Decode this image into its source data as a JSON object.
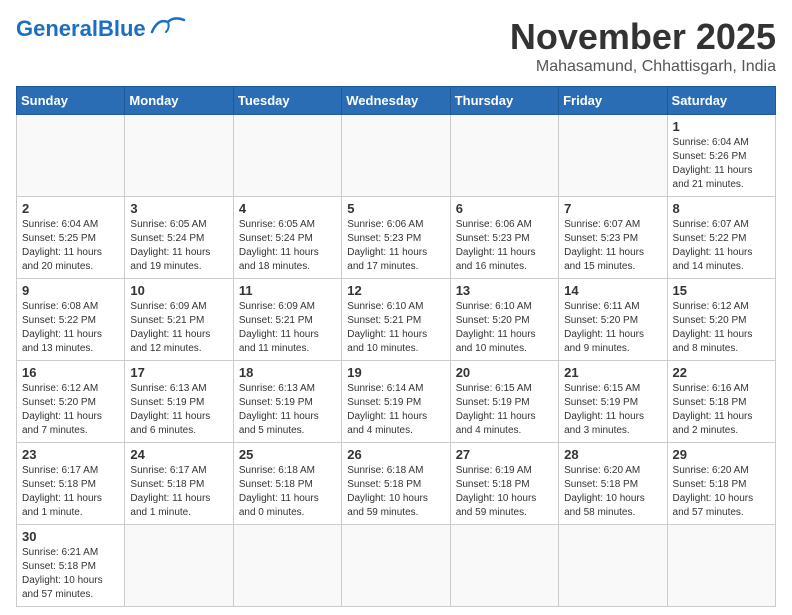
{
  "header": {
    "logo_general": "General",
    "logo_blue": "Blue",
    "month_title": "November 2025",
    "subtitle": "Mahasamund, Chhattisgarh, India"
  },
  "days_of_week": [
    "Sunday",
    "Monday",
    "Tuesday",
    "Wednesday",
    "Thursday",
    "Friday",
    "Saturday"
  ],
  "weeks": [
    [
      {
        "day": "",
        "info": ""
      },
      {
        "day": "",
        "info": ""
      },
      {
        "day": "",
        "info": ""
      },
      {
        "day": "",
        "info": ""
      },
      {
        "day": "",
        "info": ""
      },
      {
        "day": "",
        "info": ""
      },
      {
        "day": "1",
        "info": "Sunrise: 6:04 AM\nSunset: 5:26 PM\nDaylight: 11 hours\nand 21 minutes."
      }
    ],
    [
      {
        "day": "2",
        "info": "Sunrise: 6:04 AM\nSunset: 5:25 PM\nDaylight: 11 hours\nand 20 minutes."
      },
      {
        "day": "3",
        "info": "Sunrise: 6:05 AM\nSunset: 5:24 PM\nDaylight: 11 hours\nand 19 minutes."
      },
      {
        "day": "4",
        "info": "Sunrise: 6:05 AM\nSunset: 5:24 PM\nDaylight: 11 hours\nand 18 minutes."
      },
      {
        "day": "5",
        "info": "Sunrise: 6:06 AM\nSunset: 5:23 PM\nDaylight: 11 hours\nand 17 minutes."
      },
      {
        "day": "6",
        "info": "Sunrise: 6:06 AM\nSunset: 5:23 PM\nDaylight: 11 hours\nand 16 minutes."
      },
      {
        "day": "7",
        "info": "Sunrise: 6:07 AM\nSunset: 5:23 PM\nDaylight: 11 hours\nand 15 minutes."
      },
      {
        "day": "8",
        "info": "Sunrise: 6:07 AM\nSunset: 5:22 PM\nDaylight: 11 hours\nand 14 minutes."
      }
    ],
    [
      {
        "day": "9",
        "info": "Sunrise: 6:08 AM\nSunset: 5:22 PM\nDaylight: 11 hours\nand 13 minutes."
      },
      {
        "day": "10",
        "info": "Sunrise: 6:09 AM\nSunset: 5:21 PM\nDaylight: 11 hours\nand 12 minutes."
      },
      {
        "day": "11",
        "info": "Sunrise: 6:09 AM\nSunset: 5:21 PM\nDaylight: 11 hours\nand 11 minutes."
      },
      {
        "day": "12",
        "info": "Sunrise: 6:10 AM\nSunset: 5:21 PM\nDaylight: 11 hours\nand 10 minutes."
      },
      {
        "day": "13",
        "info": "Sunrise: 6:10 AM\nSunset: 5:20 PM\nDaylight: 11 hours\nand 10 minutes."
      },
      {
        "day": "14",
        "info": "Sunrise: 6:11 AM\nSunset: 5:20 PM\nDaylight: 11 hours\nand 9 minutes."
      },
      {
        "day": "15",
        "info": "Sunrise: 6:12 AM\nSunset: 5:20 PM\nDaylight: 11 hours\nand 8 minutes."
      }
    ],
    [
      {
        "day": "16",
        "info": "Sunrise: 6:12 AM\nSunset: 5:20 PM\nDaylight: 11 hours\nand 7 minutes."
      },
      {
        "day": "17",
        "info": "Sunrise: 6:13 AM\nSunset: 5:19 PM\nDaylight: 11 hours\nand 6 minutes."
      },
      {
        "day": "18",
        "info": "Sunrise: 6:13 AM\nSunset: 5:19 PM\nDaylight: 11 hours\nand 5 minutes."
      },
      {
        "day": "19",
        "info": "Sunrise: 6:14 AM\nSunset: 5:19 PM\nDaylight: 11 hours\nand 4 minutes."
      },
      {
        "day": "20",
        "info": "Sunrise: 6:15 AM\nSunset: 5:19 PM\nDaylight: 11 hours\nand 4 minutes."
      },
      {
        "day": "21",
        "info": "Sunrise: 6:15 AM\nSunset: 5:19 PM\nDaylight: 11 hours\nand 3 minutes."
      },
      {
        "day": "22",
        "info": "Sunrise: 6:16 AM\nSunset: 5:18 PM\nDaylight: 11 hours\nand 2 minutes."
      }
    ],
    [
      {
        "day": "23",
        "info": "Sunrise: 6:17 AM\nSunset: 5:18 PM\nDaylight: 11 hours\nand 1 minute."
      },
      {
        "day": "24",
        "info": "Sunrise: 6:17 AM\nSunset: 5:18 PM\nDaylight: 11 hours\nand 1 minute."
      },
      {
        "day": "25",
        "info": "Sunrise: 6:18 AM\nSunset: 5:18 PM\nDaylight: 11 hours\nand 0 minutes."
      },
      {
        "day": "26",
        "info": "Sunrise: 6:18 AM\nSunset: 5:18 PM\nDaylight: 10 hours\nand 59 minutes."
      },
      {
        "day": "27",
        "info": "Sunrise: 6:19 AM\nSunset: 5:18 PM\nDaylight: 10 hours\nand 59 minutes."
      },
      {
        "day": "28",
        "info": "Sunrise: 6:20 AM\nSunset: 5:18 PM\nDaylight: 10 hours\nand 58 minutes."
      },
      {
        "day": "29",
        "info": "Sunrise: 6:20 AM\nSunset: 5:18 PM\nDaylight: 10 hours\nand 57 minutes."
      }
    ],
    [
      {
        "day": "30",
        "info": "Sunrise: 6:21 AM\nSunset: 5:18 PM\nDaylight: 10 hours\nand 57 minutes."
      },
      {
        "day": "",
        "info": ""
      },
      {
        "day": "",
        "info": ""
      },
      {
        "day": "",
        "info": ""
      },
      {
        "day": "",
        "info": ""
      },
      {
        "day": "",
        "info": ""
      },
      {
        "day": "",
        "info": ""
      }
    ]
  ]
}
